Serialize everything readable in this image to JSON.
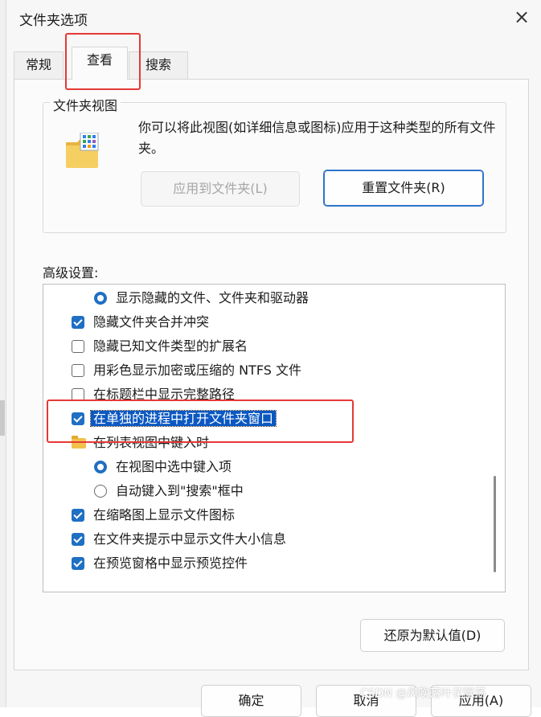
{
  "window": {
    "title": "文件夹选项",
    "close_icon": "×"
  },
  "tabs": [
    {
      "label": "常规",
      "active": false
    },
    {
      "label": "查看",
      "active": true
    },
    {
      "label": "搜索",
      "active": false
    }
  ],
  "folder_views": {
    "legend": "文件夹视图",
    "description": "你可以将此视图(如详细信息或图标)应用于这种类型的所有文件夹。",
    "apply_button": "应用到文件夹(L)",
    "reset_button": "重置文件夹(R)",
    "icon": "folder-view-icon"
  },
  "advanced": {
    "label": "高级设置:",
    "items": [
      {
        "type": "radio",
        "checked": true,
        "text": "显示隐藏的文件、文件夹和驱动器"
      },
      {
        "type": "checkbox",
        "checked": true,
        "text": "隐藏文件夹合并冲突"
      },
      {
        "type": "checkbox",
        "checked": false,
        "text": "隐藏已知文件类型的扩展名"
      },
      {
        "type": "checkbox",
        "checked": false,
        "text": "用彩色显示加密或压缩的 NTFS 文件"
      },
      {
        "type": "checkbox",
        "checked": false,
        "text": "在标题栏中显示完整路径"
      },
      {
        "type": "checkbox",
        "checked": true,
        "text": "在单独的进程中打开文件夹窗口",
        "selected": true
      },
      {
        "type": "folder",
        "text": "在列表视图中键入时"
      },
      {
        "type": "radio",
        "checked": true,
        "text": "在视图中选中键入项"
      },
      {
        "type": "radio",
        "checked": false,
        "text": "自动键入到\"搜索\"框中"
      },
      {
        "type": "checkbox",
        "checked": true,
        "text": "在缩略图上显示文件图标"
      },
      {
        "type": "checkbox",
        "checked": true,
        "text": "在文件夹提示中显示文件大小信息"
      },
      {
        "type": "checkbox",
        "checked": true,
        "text": "在预览窗格中显示预览控件"
      }
    ],
    "restore_button": "还原为默认值(D)"
  },
  "footer": {
    "ok_button": "确定",
    "cancel_button": "取消",
    "apply_button": "应用(A)"
  },
  "watermark": "CSDN @风吹落叶花飘荡",
  "colors": {
    "accent": "#1f6fc2",
    "highlight": "#0b58c2",
    "annotation": "#e53935"
  }
}
